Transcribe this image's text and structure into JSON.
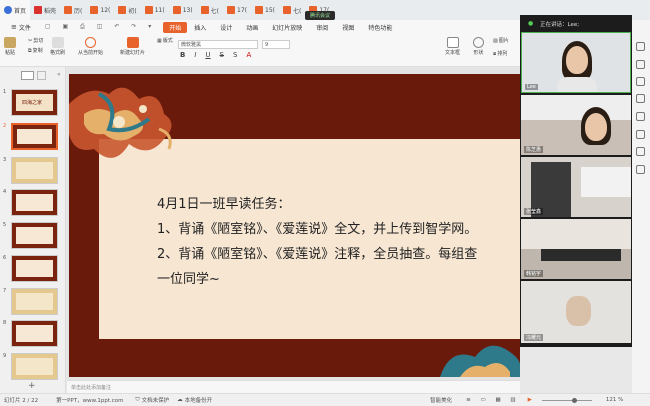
{
  "tabs": [
    {
      "label": "首页",
      "type": "home"
    },
    {
      "label": "稻壳",
      "type": "docer"
    },
    {
      "label": "历(",
      "type": "ppt"
    },
    {
      "label": "12(",
      "type": "ppt"
    },
    {
      "label": "初(",
      "type": "ppt"
    },
    {
      "label": "11(",
      "type": "ppt"
    },
    {
      "label": "13(",
      "type": "ppt"
    },
    {
      "label": "七(",
      "type": "ppt"
    },
    {
      "label": "17(",
      "type": "ppt"
    },
    {
      "label": "15(",
      "type": "ppt"
    },
    {
      "label": "七(",
      "type": "ppt"
    },
    {
      "label": "17(",
      "type": "ppt"
    }
  ],
  "meeting_pill": "腾讯会议",
  "menu": {
    "file": "文件",
    "items": [
      "开始",
      "插入",
      "设计",
      "动画",
      "幻灯片放映",
      "审阅",
      "视图",
      "特色功能"
    ],
    "active": "开始"
  },
  "toolbar": {
    "paste": "粘贴",
    "cut": "剪切",
    "copy": "复制",
    "format_painter": "格式刷",
    "from_current": "从当前开始",
    "new_slide": "新建幻灯片",
    "layout": "版式",
    "font_value": "微软雅黑",
    "size_value": "9",
    "textbox": "文本框",
    "shape": "形状",
    "picture": "图片",
    "arrange": "排列"
  },
  "thumbnails": [
    {
      "num": "1",
      "title": "四海之家"
    },
    {
      "num": "2",
      "title": ""
    },
    {
      "num": "3",
      "title": ""
    },
    {
      "num": "4",
      "title": ""
    },
    {
      "num": "5",
      "title": ""
    },
    {
      "num": "6",
      "title": ""
    },
    {
      "num": "7",
      "title": ""
    },
    {
      "num": "8",
      "title": ""
    },
    {
      "num": "9",
      "title": ""
    }
  ],
  "selected_thumb": "2",
  "slide": {
    "line1": "4月1日一班早读任务：",
    "line2": "1、背诵《陋室铭》、《爱莲说》全文，并上传到智学网。",
    "line3": "2、背诵《陋室铭》、《爱莲说》注释，全员抽查。每组查",
    "line4": "一位同学~"
  },
  "notes_placeholder": "单击此处添加备注",
  "status": {
    "slide_count": "幻灯片 2 / 22",
    "template": "第一PPT，www.1ppt.com",
    "protect": "文档未保护",
    "backup": "本地备份开",
    "beautify": "智能美化",
    "zoom": "121 %"
  },
  "meeting": {
    "title": "正在讲话：Lee;",
    "participants": [
      "Lee",
      "陈芝惠",
      "张莹鑫",
      "韩铭宇",
      "冯耀元"
    ]
  }
}
